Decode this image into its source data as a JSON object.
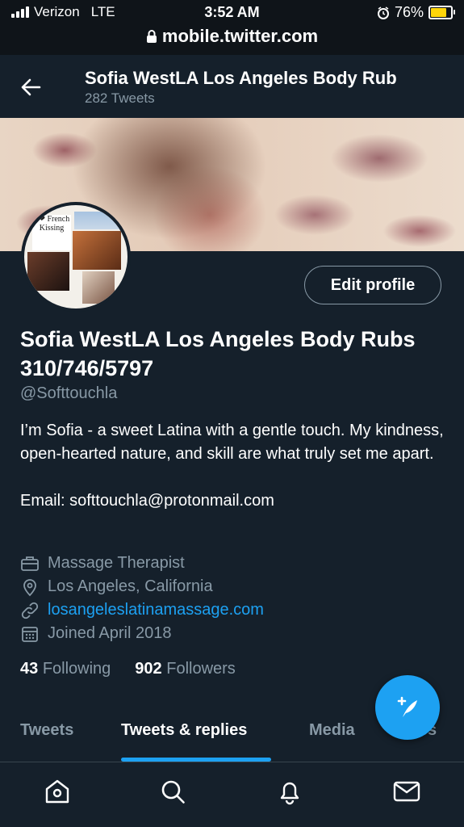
{
  "status_bar": {
    "carrier": "Verizon",
    "network": "LTE",
    "time": "3:52 AM",
    "battery": "76%",
    "battery_level": 0.76,
    "url": "mobile.twitter.com"
  },
  "header": {
    "title": "Sofia WestLA Los Angeles Body Rub",
    "tweet_count": "282 Tweets"
  },
  "avatar": {
    "overlay_text": "I ❤ French Kissing"
  },
  "profile": {
    "edit_button": "Edit profile",
    "name": "Sofia WestLA Los Angeles Body Rubs 310/746/5797",
    "handle": "@Softtouchla",
    "bio": "I’m Sofia - a sweet Latina with a gentle touch. My kindness, open-hearted nature, and skill are what truly set me apart.\n\nEmail: softtouchla@protonmail.com",
    "category": "Massage Therapist",
    "location": "Los Angeles, California",
    "website": "losangeleslatinamassage.com",
    "joined": "Joined April 2018",
    "following_count": "43",
    "following_label": "Following",
    "followers_count": "902",
    "followers_label": "Followers"
  },
  "tabs": [
    {
      "label": "Tweets"
    },
    {
      "label": "Tweets & replies"
    },
    {
      "label": "Media"
    },
    {
      "label": "Likes"
    }
  ],
  "active_tab": "Tweets & replies",
  "colors": {
    "background": "#15202b",
    "accent": "#1da1f2",
    "secondary_text": "#8899a6"
  },
  "icons": {
    "fab": "compose-tweet-icon",
    "nav": [
      "home-icon",
      "search-icon",
      "notifications-icon",
      "messages-icon"
    ]
  }
}
